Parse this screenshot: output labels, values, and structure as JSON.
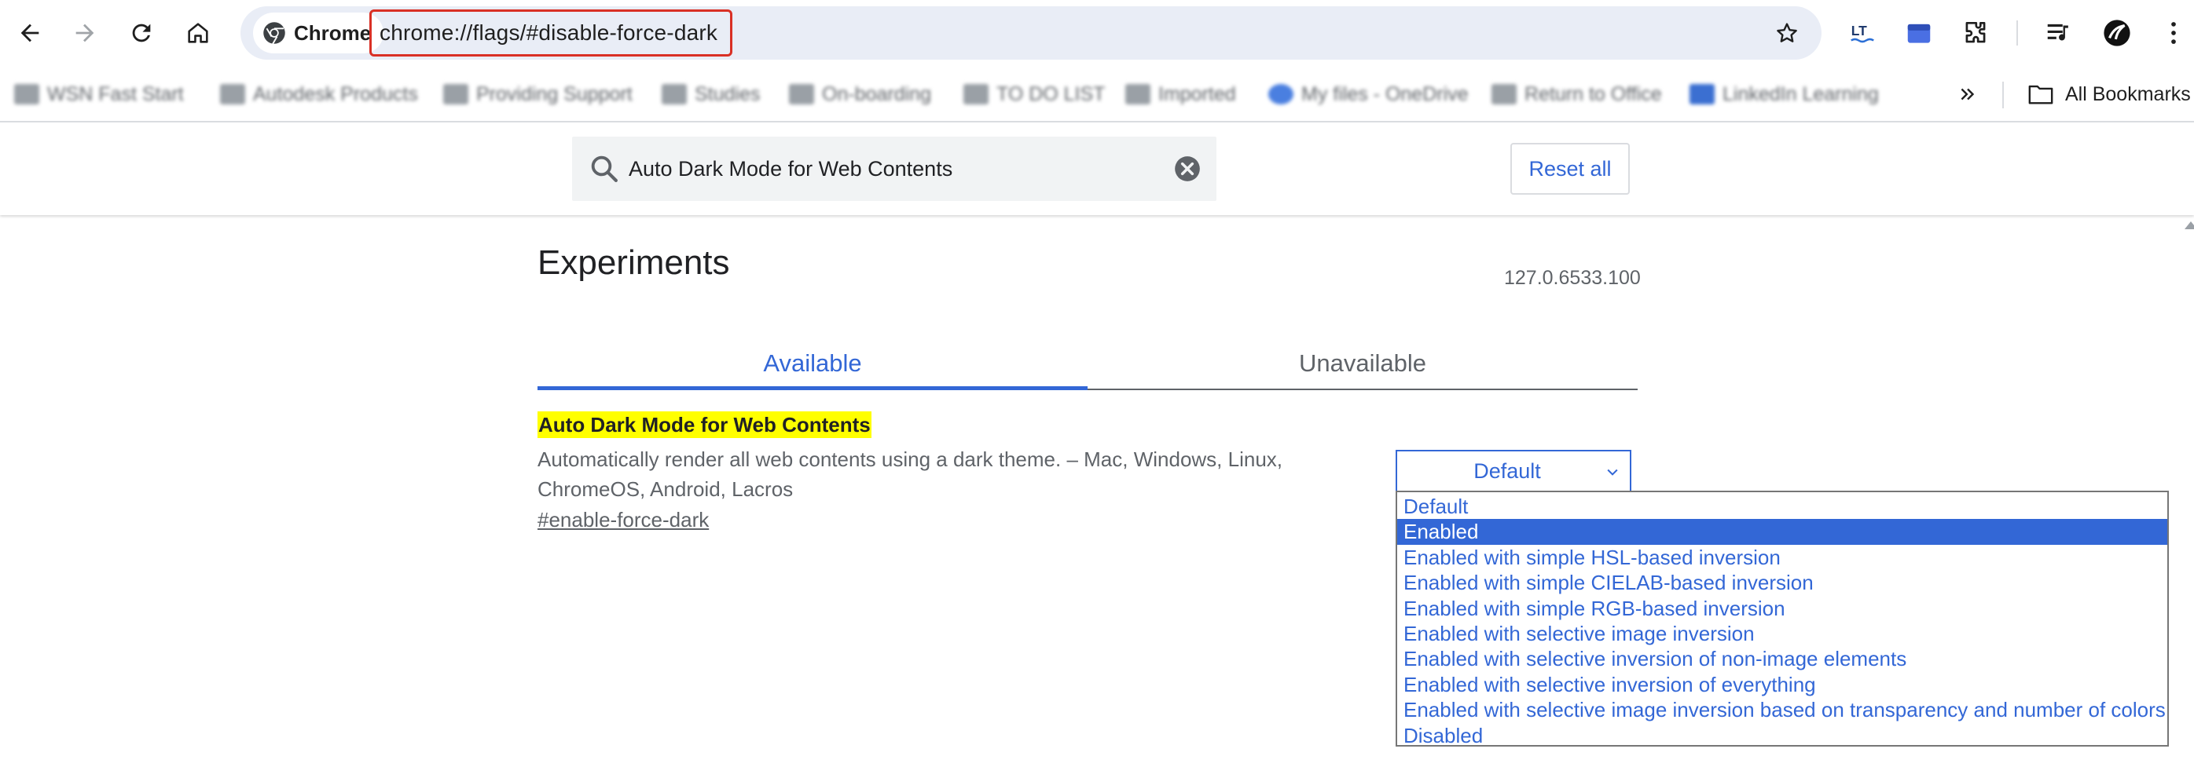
{
  "browser": {
    "chip_label": "Chrome",
    "url": "chrome://flags/#disable-force-dark",
    "icons": [
      "back-icon",
      "forward-icon",
      "reload-icon",
      "home-icon",
      "chrome-logo-icon",
      "star-icon",
      "lt-extension-icon",
      "calendar-extension-icon",
      "puzzle-extensions-icon",
      "media-icon",
      "profile-avatar-icon",
      "kebab-menu-icon"
    ]
  },
  "bookmarks": {
    "items": [
      "WSN Fast Start",
      "Autodesk Products",
      "Providing Support",
      "Studies",
      "On-boarding",
      "TO DO LIST",
      "Imported",
      "My files - OneDrive",
      "Return to Office",
      "LinkedIn Learning"
    ],
    "all_bookmarks_label": "All Bookmarks"
  },
  "flags": {
    "search_value": "Auto Dark Mode for Web Contents",
    "reset_all_label": "Reset all",
    "page_title": "Experiments",
    "version": "127.0.6533.100",
    "tabs": {
      "available": "Available",
      "unavailable": "Unavailable"
    },
    "experiment": {
      "title": "Auto Dark Mode for Web Contents",
      "description": "Automatically render all web contents using a dark theme. – Mac, Windows, Linux, ChromeOS, Android, Lacros",
      "link": "#enable-force-dark",
      "select_value": "Default",
      "options": [
        "Default",
        "Enabled",
        "Enabled with simple HSL-based inversion",
        "Enabled with simple CIELAB-based inversion",
        "Enabled with simple RGB-based inversion",
        "Enabled with selective image inversion",
        "Enabled with selective inversion of non-image elements",
        "Enabled with selective inversion of everything",
        "Enabled with selective image inversion based on transparency and number of colors",
        "Disabled"
      ],
      "highlighted_option": "Enabled"
    }
  },
  "colors": {
    "accent": "#3367d6",
    "highlight": "#ffff00",
    "url_outline": "#d93025",
    "omnibox_bg": "#e9edf6"
  }
}
